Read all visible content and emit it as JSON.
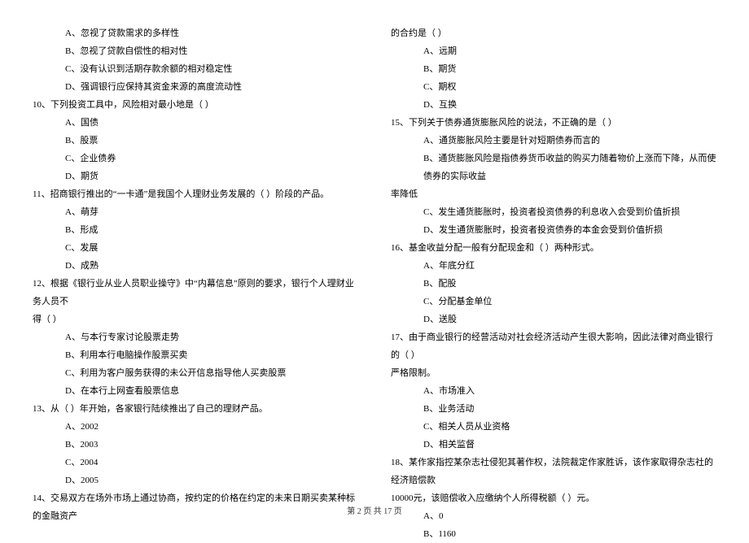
{
  "left": {
    "l1": "A、忽视了贷款需求的多样性",
    "l2": "B、忽视了贷款自偿性的相对性",
    "l3": "C、没有认识到活期存款余额的相对稳定性",
    "l4": "D、强调银行应保持其资金来源的高度流动性",
    "q10": "10、下列投资工具中，风险相对最小地是（    ）",
    "q10a": "A、国债",
    "q10b": "B、股票",
    "q10c": "C、企业债券",
    "q10d": "D、期货",
    "q11": "11、招商银行推出的“一卡通”是我国个人理财业务发展的（    ）阶段的产品。",
    "q11a": "A、萌芽",
    "q11b": "B、形成",
    "q11c": "C、发展",
    "q11d": "D、成熟",
    "q12": "12、根据《银行业从业人员职业操守》中“内幕信息”原则的要求，银行个人理财业务人员不",
    "q12_2": "得（    ）",
    "q12a": "A、与本行专家讨论股票走势",
    "q12b": "B、利用本行电脑操作股票买卖",
    "q12c": "C、利用为客户服务获得的未公开信息指导他人买卖股票",
    "q12d": "D、在本行上网查看股票信息",
    "q13": "13、从（    ）年开始，各家银行陆续推出了自己的理财产品。",
    "q13a": "A、2002",
    "q13b": "B、2003",
    "q13c": "C、2004",
    "q13d": "D、2005",
    "q14": "14、交易双方在场外市场上通过协商，按约定的价格在约定的未来日期买卖某种标的金融资产"
  },
  "right": {
    "q14_2": "的合约是（    ）",
    "q14a": "A、远期",
    "q14b": "B、期货",
    "q14c": "C、期权",
    "q14d": "D、互换",
    "q15": "15、下列关于债券通货膨胀风险的说法，不正确的是（    ）",
    "q15a": "A、通货膨胀风险主要是针对短期债券而言的",
    "q15b": "B、通货膨胀风险是指债券货币收益的购买力随着物价上涨而下降，从而使债券的实际收益",
    "q15b_2": "率降低",
    "q15c": "C、发生通货膨胀时，投资者投资债券的利息收入会受到价值折损",
    "q15d": "D、发生通货膨胀时，投资者投资债券的本金会受到价值折损",
    "q16": "16、基金收益分配一般有分配现金和（    ）两种形式。",
    "q16a": "A、年底分红",
    "q16b": "B、配股",
    "q16c": "C、分配基金单位",
    "q16d": "D、送股",
    "q17": "17、由于商业银行的经营活动对社会经济活动产生很大影响，因此法律对商业银行的（    ）",
    "q17_2": "严格限制。",
    "q17a": "A、市场准入",
    "q17b": "B、业务活动",
    "q17c": "C、相关人员从业资格",
    "q17d": "D、相关监督",
    "q18": "18、某作家指控某杂志社侵犯其著作权，法院裁定作家胜诉，该作家取得杂志社的经济赔偿款",
    "q18_2": "10000元，该赔偿收入应缴纳个人所得税额（    ）元。",
    "q18a": "A、0",
    "q18b": "B、1160"
  },
  "footer": "第 2 页 共 17 页"
}
